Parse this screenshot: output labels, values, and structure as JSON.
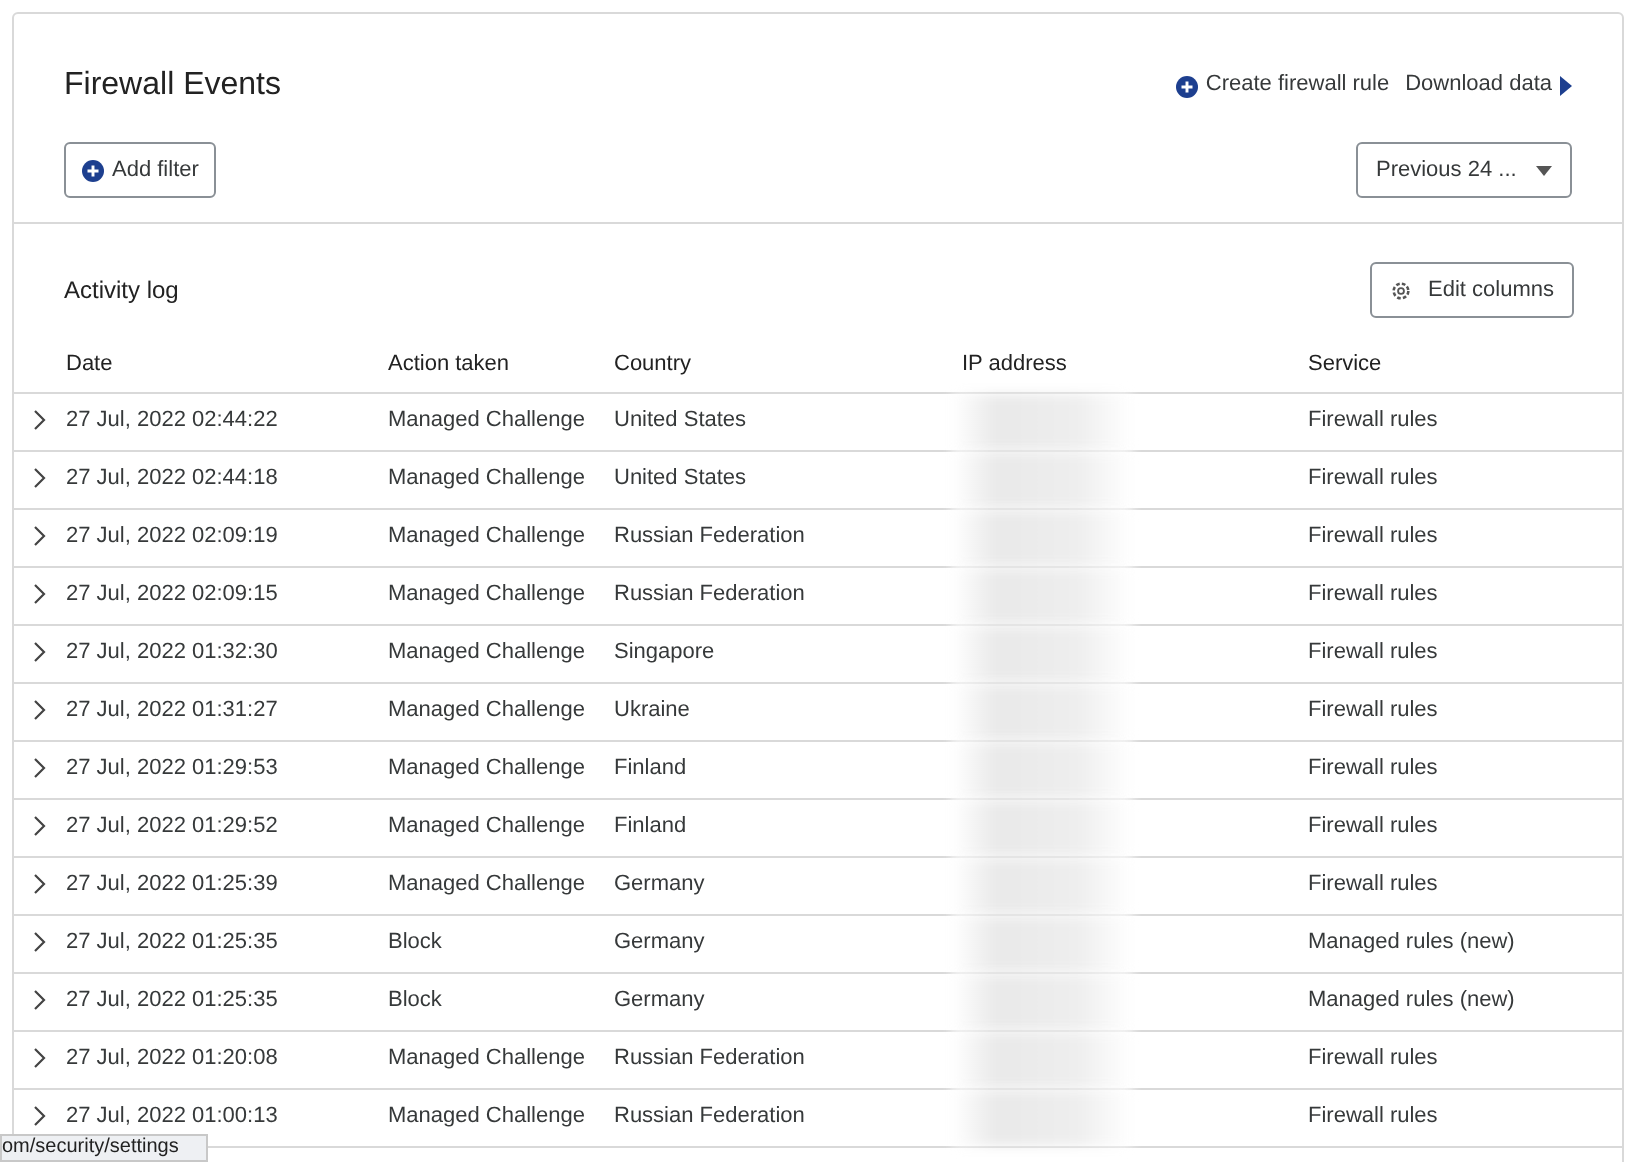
{
  "header": {
    "title": "Firewall Events",
    "links": [
      "Create firewall rule",
      "Download data"
    ],
    "add_filter": "Add filter",
    "time_range": "Previous 24 ..."
  },
  "activity_log": {
    "title": "Activity log",
    "edit_columns": "Edit columns",
    "columns": [
      "Date",
      "Action taken",
      "Country",
      "IP address",
      "Service"
    ],
    "rows": [
      {
        "date": "27 Jul, 2022 02:44:22",
        "action": "Managed Challenge",
        "country": "United States",
        "service": "Firewall rules"
      },
      {
        "date": "27 Jul, 2022 02:44:18",
        "action": "Managed Challenge",
        "country": "United States",
        "service": "Firewall rules"
      },
      {
        "date": "27 Jul, 2022 02:09:19",
        "action": "Managed Challenge",
        "country": "Russian Federation",
        "service": "Firewall rules"
      },
      {
        "date": "27 Jul, 2022 02:09:15",
        "action": "Managed Challenge",
        "country": "Russian Federation",
        "service": "Firewall rules"
      },
      {
        "date": "27 Jul, 2022 01:32:30",
        "action": "Managed Challenge",
        "country": "Singapore",
        "service": "Firewall rules"
      },
      {
        "date": "27 Jul, 2022 01:31:27",
        "action": "Managed Challenge",
        "country": "Ukraine",
        "service": "Firewall rules"
      },
      {
        "date": "27 Jul, 2022 01:29:53",
        "action": "Managed Challenge",
        "country": "Finland",
        "service": "Firewall rules"
      },
      {
        "date": "27 Jul, 2022 01:29:52",
        "action": "Managed Challenge",
        "country": "Finland",
        "service": "Firewall rules"
      },
      {
        "date": "27 Jul, 2022 01:25:39",
        "action": "Managed Challenge",
        "country": "Germany",
        "service": "Firewall rules"
      },
      {
        "date": "27 Jul, 2022 01:25:35",
        "action": "Block",
        "country": "Germany",
        "service": "Managed rules (new)"
      },
      {
        "date": "27 Jul, 2022 01:25:35",
        "action": "Block",
        "country": "Germany",
        "service": "Managed rules (new)"
      },
      {
        "date": "27 Jul, 2022 01:20:08",
        "action": "Managed Challenge",
        "country": "Russian Federation",
        "service": "Firewall rules"
      },
      {
        "date": "27 Jul, 2022 01:00:13",
        "action": "Managed Challenge",
        "country": "Russian Federation",
        "service": "Firewall rules"
      }
    ]
  },
  "status_url": "om/security/settings"
}
